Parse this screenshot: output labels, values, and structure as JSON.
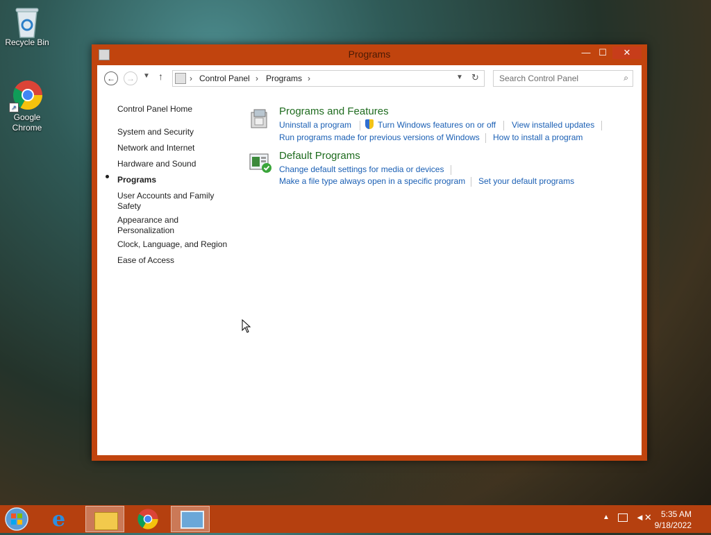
{
  "desktop": {
    "icons": [
      {
        "label": "Recycle Bin",
        "icon": "recycle-bin-icon"
      },
      {
        "label": "Google Chrome",
        "icon": "chrome-icon"
      }
    ]
  },
  "window": {
    "title": "Programs",
    "buttons": {
      "minimize": "—",
      "maximize": "☐",
      "close": "✕"
    }
  },
  "address": {
    "breadcrumb": [
      "Control Panel",
      "Programs"
    ],
    "search_placeholder": "Search Control Panel"
  },
  "nav": {
    "home": "Control Panel Home",
    "items": [
      {
        "label": "System and Security"
      },
      {
        "label": "Network and Internet"
      },
      {
        "label": "Hardware and Sound"
      },
      {
        "label": "Programs",
        "selected": true
      },
      {
        "label": "User Accounts and Family Safety"
      },
      {
        "label": "Appearance and Personalization"
      },
      {
        "label": "Clock, Language, and Region"
      },
      {
        "label": "Ease of Access"
      }
    ]
  },
  "categories": [
    {
      "title": "Programs and Features",
      "links": [
        "Uninstall a program",
        "Turn Windows features on or off",
        "View installed updates",
        "Run programs made for previous versions of Windows",
        "How to install a program"
      ]
    },
    {
      "title": "Default Programs",
      "links": [
        "Change default settings for media or devices",
        "Make a file type always open in a specific program",
        "Set your default programs"
      ]
    }
  ],
  "taskbar": {
    "apps": [
      "start-button",
      "internet-explorer",
      "file-explorer",
      "chrome",
      "control-panel"
    ],
    "time": "5:35 AM",
    "date": "9/18/2022"
  },
  "colors": {
    "accent": "#c1440e",
    "link": "#1a5fb4",
    "category": "#1e6b1e"
  }
}
